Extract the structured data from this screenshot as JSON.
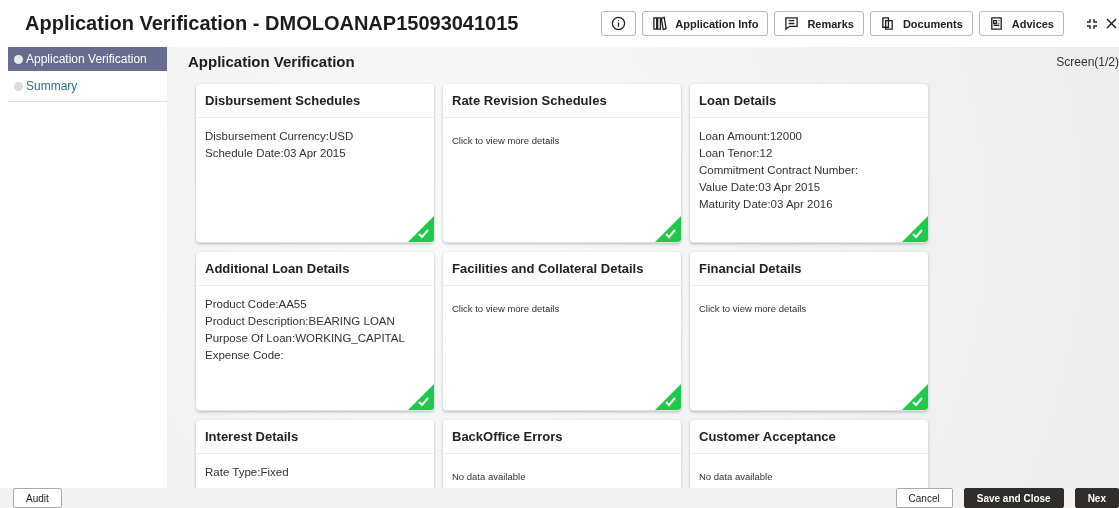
{
  "header": {
    "title": "Application Verification - DMOLOANAP15093041015",
    "buttons": [
      {
        "kind": "info"
      },
      {
        "kind": "books",
        "label": "Application Info"
      },
      {
        "kind": "remarks",
        "label": "Remarks"
      },
      {
        "kind": "documents",
        "label": "Documents"
      },
      {
        "kind": "advices",
        "label": "Advices"
      }
    ]
  },
  "sidebar": {
    "items": [
      {
        "label": "Application Verification",
        "selected": true
      },
      {
        "label": "Summary",
        "selected": false
      }
    ]
  },
  "main": {
    "heading": "Application Verification",
    "screen": "Screen(1/2)",
    "cards": [
      {
        "title": "Disbursement Schedules",
        "kind": "fields",
        "lines": [
          "Disbursement Currency:USD",
          "Schedule Date:03 Apr 2015"
        ],
        "verified": true
      },
      {
        "title": "Rate Revision Schedules",
        "kind": "note",
        "lines": [
          "Click to view more details"
        ],
        "verified": true
      },
      {
        "title": "Loan Details",
        "kind": "fields",
        "lines": [
          "Loan Amount:12000",
          "Loan Tenor:12",
          "Commitment Contract Number:",
          "Value Date:03 Apr 2015",
          "Maturity Date:03 Apr 2016"
        ],
        "verified": true
      },
      {
        "title": "Additional Loan Details",
        "kind": "fields",
        "lines": [
          "Product Code:AA55",
          "Product Description:BEARING LOAN",
          "Purpose Of Loan:WORKING_CAPITAL",
          "Expense Code:"
        ],
        "verified": true
      },
      {
        "title": "Facilities and Collateral Details",
        "kind": "note",
        "lines": [
          "Click to view more details"
        ],
        "verified": true
      },
      {
        "title": "Financial Details",
        "kind": "note",
        "lines": [
          "Click to view more details"
        ],
        "verified": true
      },
      {
        "title": "Interest Details",
        "kind": "fields",
        "lines": [
          "Rate Type:Fixed"
        ]
      },
      {
        "title": "BackOffice Errors",
        "kind": "note",
        "lines": [
          "No data available"
        ]
      },
      {
        "title": "Customer Acceptance",
        "kind": "note",
        "lines": [
          "No data available"
        ]
      }
    ]
  },
  "footer": {
    "left": [
      {
        "label": "Audit",
        "kind": "plain"
      }
    ],
    "right": [
      {
        "label": "Cancel",
        "kind": "plain"
      },
      {
        "label": "Save and Close",
        "kind": "dark"
      },
      {
        "label": "Nex",
        "kind": "dark"
      }
    ]
  }
}
